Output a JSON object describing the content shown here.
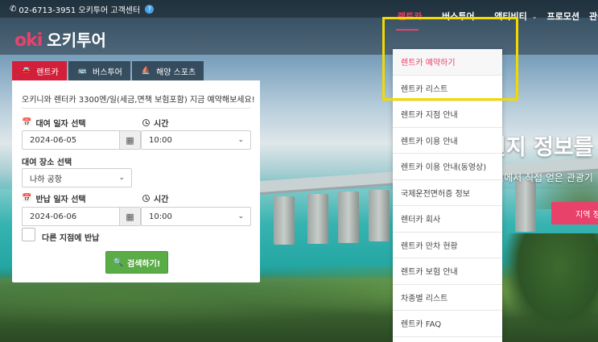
{
  "topbar": {
    "phone_text": "02-6713-3951 오키투어 고객센터",
    "phone_icon": "phone-icon",
    "help_icon": "help-icon"
  },
  "logo": {
    "mark": "oki",
    "name": "오키투어"
  },
  "nav": {
    "items": [
      {
        "label": "렌트카",
        "active": true
      },
      {
        "label": "버스투어",
        "active": false
      },
      {
        "label": "액티비티",
        "active": false
      },
      {
        "label": "프로모션",
        "active": false
      },
      {
        "label": "관광",
        "active": false
      }
    ]
  },
  "dropdown": {
    "items": [
      {
        "label": "렌트카 예약하기",
        "active": true
      },
      {
        "label": "렌트카 리스트"
      },
      {
        "label": "렌트카 지점 안내"
      },
      {
        "label": "렌트카 이용 안내"
      },
      {
        "label": "렌트카 이용 안내(동영상)"
      },
      {
        "label": "국제운전면허증 정보"
      },
      {
        "label": "렌터카 회사"
      },
      {
        "label": "렌트카 만차 현황"
      },
      {
        "label": "렌트카 보험 안내"
      },
      {
        "label": "차종별 리스트"
      },
      {
        "label": "렌트카 FAQ"
      }
    ]
  },
  "hero": {
    "title": "현지 정보를",
    "subtitle": "현지에서 직접 얻은 관광기",
    "button": "지역 정"
  },
  "tabs": [
    {
      "label": "렌트카",
      "icon": "car-icon",
      "active": true
    },
    {
      "label": "버스투어",
      "icon": "bus-icon",
      "active": false
    },
    {
      "label": "해양 스포츠",
      "icon": "boat-icon",
      "active": false
    }
  ],
  "form": {
    "intro": "오키니와 렌터카 3300엔/일(세금,면책 보험포함) 지금 예약해보세요!",
    "pickup_date_label": "대여 일자 선택",
    "pickup_date_value": "2024-06-05",
    "pickup_time_label": "시간",
    "pickup_time_value": "10:00",
    "location_label": "대여 장소 선택",
    "location_value": "나하 공항",
    "return_date_label": "반납 일자 선택",
    "return_date_value": "2024-06-06",
    "return_time_label": "시간",
    "return_time_value": "10:00",
    "different_return_label": "다른 지점에 반납",
    "search_button": "검색하기!"
  },
  "colors": {
    "accent": "#e8426b",
    "tab_active": "#d3203a",
    "search": "#5aac46",
    "highlight": "#f2da00"
  }
}
